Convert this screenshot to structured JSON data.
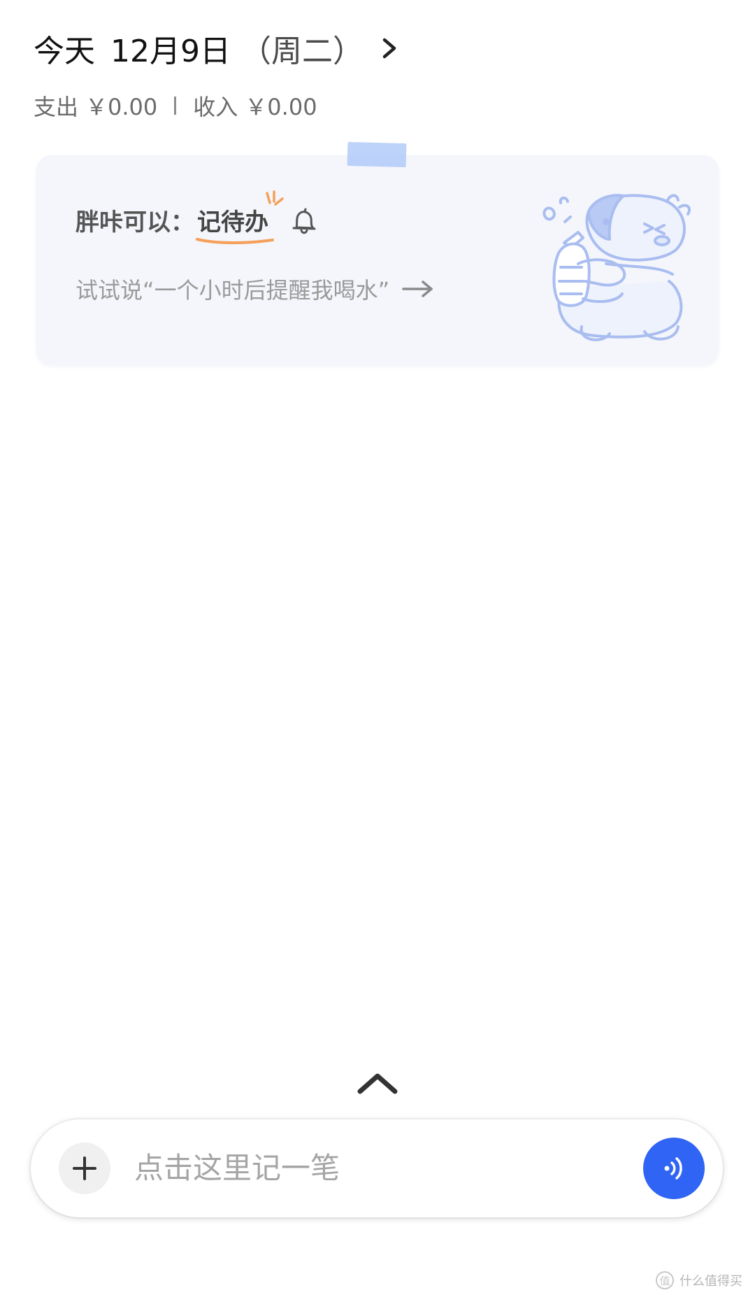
{
  "header": {
    "today_label": "今天",
    "date": "12月9日",
    "weekday": "（周二）",
    "expense_label": "支出",
    "expense_amount": "￥0.00",
    "income_label": "收入",
    "income_amount": "￥0.00"
  },
  "tip_card": {
    "title_prefix": "胖咔可以：",
    "feature": "记待办",
    "hint": "试试说“一个小时后提醒我喝水”",
    "icons": [
      "bell-icon",
      "arrow-right-icon",
      "mascot-illustration"
    ]
  },
  "input_bar": {
    "placeholder": "点击这里记一笔",
    "icons": [
      "plus-icon",
      "voice-icon",
      "chevron-up-icon"
    ]
  },
  "watermark": {
    "badge": "值",
    "text": "什么值得买"
  },
  "colors": {
    "accent_blue": "#2f64f5",
    "card_bg": "#f4f6fb",
    "tape": "#a8c4f8",
    "highlight_orange": "#f5a05a",
    "mascot_stroke": "#a9bdf0"
  }
}
